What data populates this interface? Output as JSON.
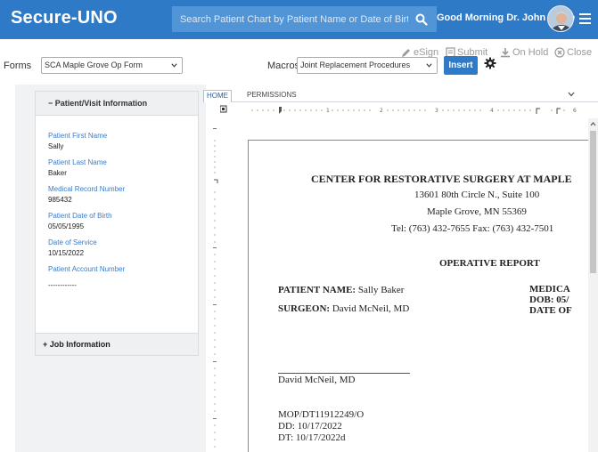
{
  "header": {
    "brand": "Secure-UNO",
    "search_placeholder": "Search Patient Chart by Patient Name or Date of Birth",
    "greeting": "Good Morning Dr. John White"
  },
  "toolbar": {
    "esign": "eSign",
    "submit": "Submit",
    "on_hold": "On Hold",
    "close": "Close",
    "forms_label": "Forms",
    "forms_value": "SCA Maple Grove Op Form",
    "macros_label": "Macros",
    "macros_value": "Joint Replacement Procedures",
    "insert": "Insert"
  },
  "left_panel": {
    "section1_title": "Patient/Visit Information",
    "fields": [
      {
        "label": "Patient First Name",
        "value": "Sally"
      },
      {
        "label": "Patient Last Name",
        "value": "Baker"
      },
      {
        "label": "Medical Record Number",
        "value": "985432"
      },
      {
        "label": "Patient Date of Birth",
        "value": "05/05/1995"
      },
      {
        "label": "Date of Service",
        "value": "10/15/2022"
      },
      {
        "label": "Patient Account Number",
        "value": "------------"
      }
    ],
    "section2_title": "Job Information"
  },
  "editor": {
    "tabs": [
      "HOME",
      "PERMISSIONS"
    ],
    "doc": {
      "facility": "CENTER FOR RESTORATIVE SURGERY AT MAPLE",
      "address1": "13601 80th Circle N., Suite 100",
      "address2": "Maple Grove, MN 55369",
      "phone": "Tel: (763) 432-7655  Fax: (763) 432-7501",
      "report_title": "OPERATIVE REPORT",
      "patient_name_label": "PATIENT NAME:",
      "patient_name": "Sally Baker",
      "surgeon_label": "SURGEON:",
      "surgeon": "David McNeil, MD",
      "medical_label": "MEDICA",
      "dob_label": "DOB: 05/",
      "date_label": "DATE OF",
      "signature_name": "David McNeil, MD",
      "job_code": "MOP/DT11912249/O",
      "dd": "DD:  10/17/2022",
      "dt": "DT:  10/17/2022d"
    }
  },
  "colors": {
    "brand_blue": "#2e7ac6",
    "label_blue": "#3d7cc4"
  }
}
